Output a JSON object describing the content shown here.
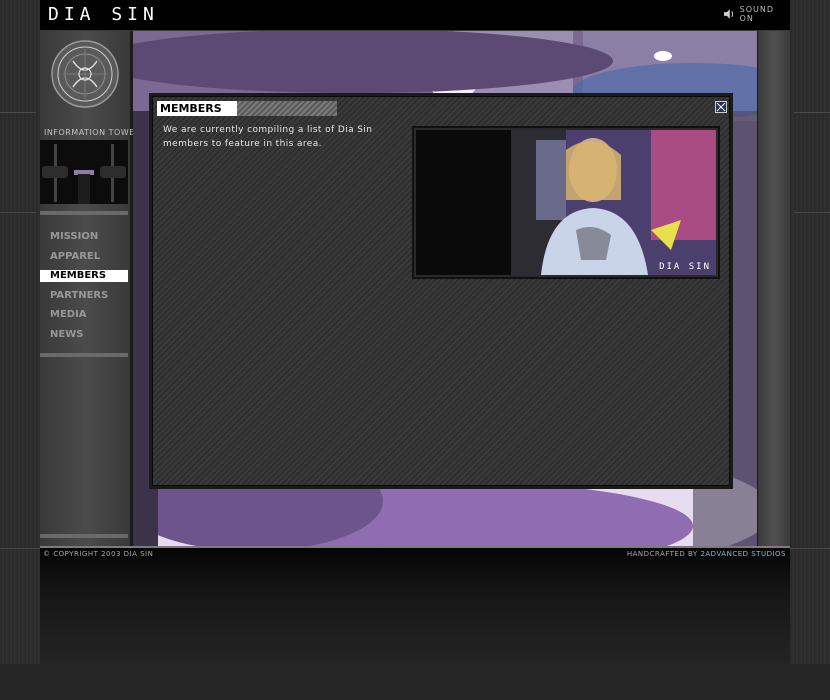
{
  "header": {
    "brand": "DIA SIN",
    "sound_label": "SOUND ON"
  },
  "sidebar": {
    "info_label": "INFORMATION TOWER",
    "nav": [
      {
        "label": "MISSION"
      },
      {
        "label": "APPAREL"
      },
      {
        "label": "MEMBERS",
        "active": true
      },
      {
        "label": "PARTNERS"
      },
      {
        "label": "MEDIA"
      },
      {
        "label": "NEWS"
      }
    ]
  },
  "panel": {
    "title": "MEMBERS",
    "description": "We are currently compiling a list of Dia Sin members to feature in this area.",
    "photo_caption": "DIA SIN"
  },
  "footer": {
    "copyright": "© COPYRIGHT 2003 DIA SIN",
    "credit_prefix": "HANDCRAFTED BY",
    "credit_link": "2ADVANCED STUDIOS"
  },
  "colors": {
    "accent_link": "#76c1d6",
    "active_nav_bg": "#ffffff",
    "close_button_bg": "#2a2f55"
  }
}
